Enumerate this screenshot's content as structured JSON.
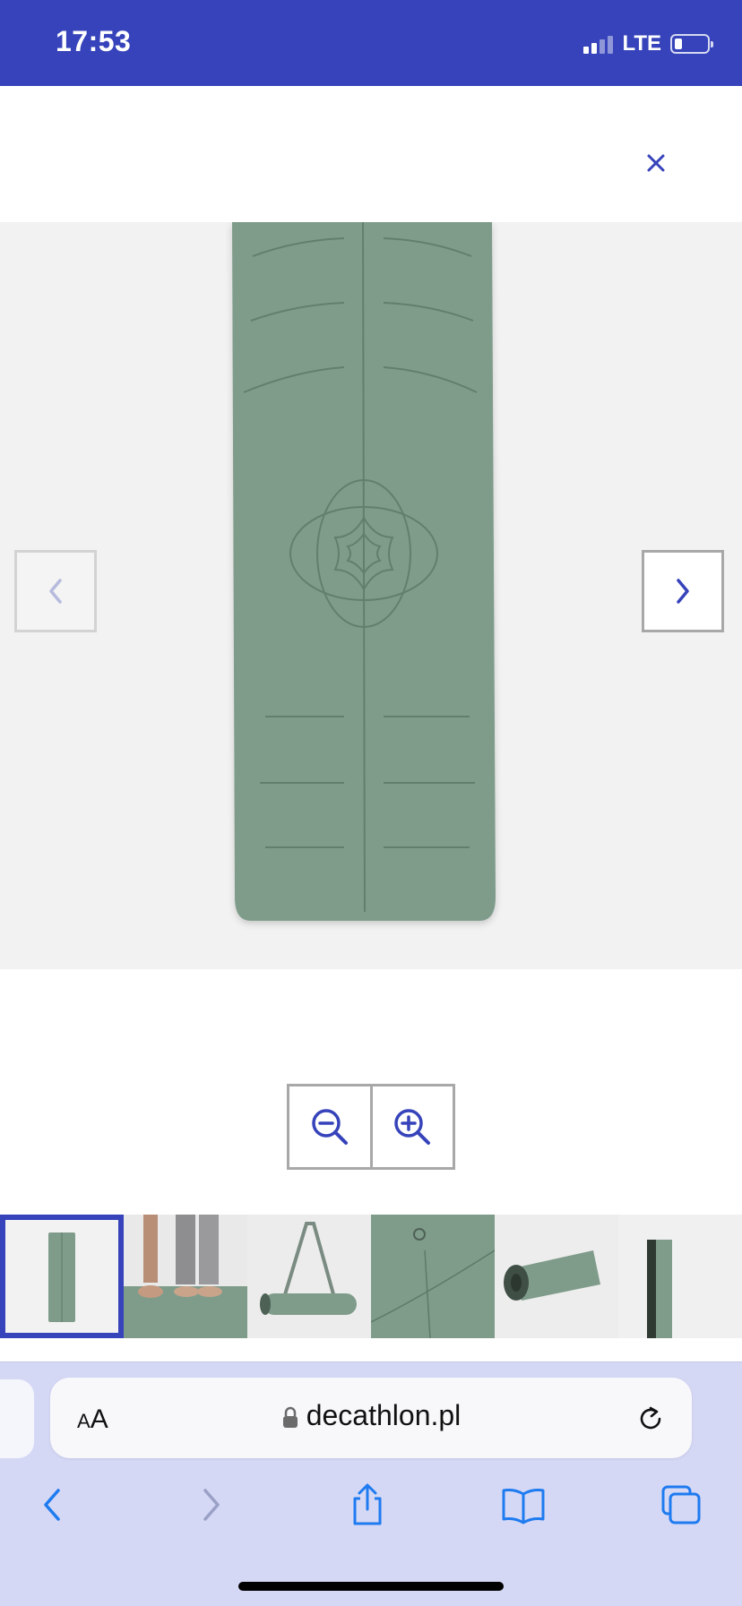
{
  "status_bar": {
    "time": "17:53",
    "network": "LTE",
    "battery_level": 0.2,
    "signal_bars": 2
  },
  "header": {
    "close_icon": "close-icon",
    "close_label": "×"
  },
  "gallery": {
    "prev_icon": "chevron-left-icon",
    "next_icon": "chevron-right-icon",
    "main_image": "green yoga mat with alignment lines",
    "thumbnails": [
      {
        "icon": "yoga-mat-thumbnail",
        "active": true
      },
      {
        "icon": "feet-on-mat-thumbnail",
        "active": false
      },
      {
        "icon": "rolled-mat-strap-thumbnail",
        "active": false
      },
      {
        "icon": "mat-closeup-thumbnail",
        "active": false
      },
      {
        "icon": "mat-rolling-thumbnail",
        "active": false
      },
      {
        "icon": "mat-rolled-upright-thumbnail",
        "active": false
      }
    ]
  },
  "zoom": {
    "zoom_out_icon": "zoom-out-icon",
    "zoom_in_icon": "zoom-in-icon"
  },
  "browser": {
    "text_size_label_small": "A",
    "text_size_label_large": "A",
    "url": "decathlon.pl",
    "reload_icon": "reload-icon",
    "toolbar": [
      "back-icon",
      "forward-icon",
      "share-icon",
      "bookmarks-icon",
      "tabs-icon"
    ]
  },
  "colors": {
    "brand": "#3643ba",
    "mat_green": "#7f9c8b",
    "browser_bar": "#d5d8f5",
    "safari_blue": "#1e7bf0"
  }
}
